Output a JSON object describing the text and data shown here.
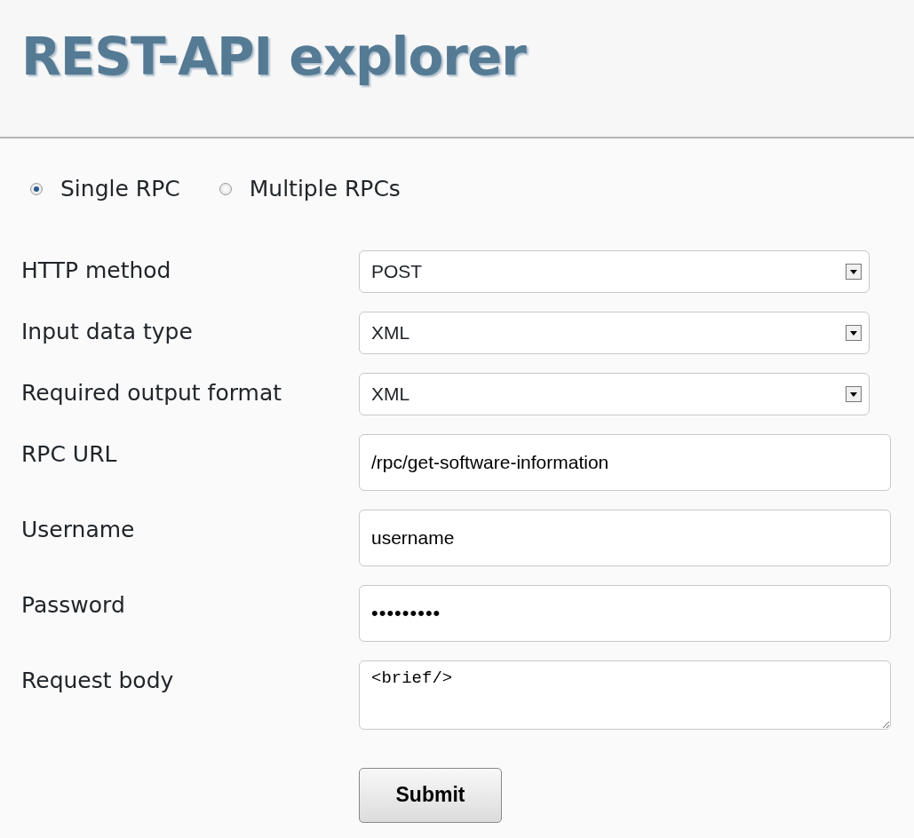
{
  "header": {
    "title": "REST-API explorer"
  },
  "mode_options": [
    {
      "label": "Single RPC",
      "selected": true
    },
    {
      "label": "Multiple RPCs",
      "selected": false
    }
  ],
  "fields": [
    {
      "kind": "select",
      "label": "HTTP method",
      "value": "POST"
    },
    {
      "kind": "select",
      "label": "Input data type",
      "value": "XML"
    },
    {
      "kind": "select",
      "label": "Required output format",
      "value": "XML"
    },
    {
      "kind": "text",
      "label": "RPC URL",
      "value": "/rpc/get-software-information"
    },
    {
      "kind": "text",
      "label": "Username",
      "value": "username"
    },
    {
      "kind": "password",
      "label": "Password",
      "value": "•••••••••"
    },
    {
      "kind": "textarea",
      "label": "Request body",
      "value": "<brief/>"
    }
  ],
  "submit_button": {
    "label": "Submit"
  }
}
